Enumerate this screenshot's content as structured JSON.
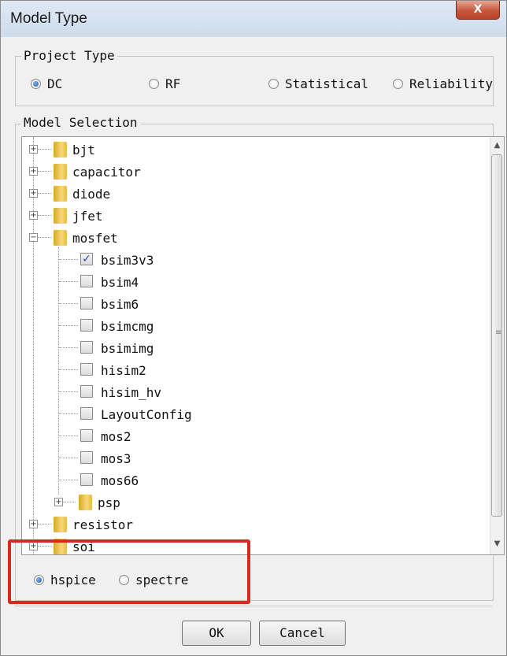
{
  "window": {
    "title": "Model Type",
    "close_glyph": "X"
  },
  "project_type": {
    "legend": "Project Type",
    "options": [
      {
        "label": "DC",
        "selected": true
      },
      {
        "label": "RF",
        "selected": false
      },
      {
        "label": "Statistical",
        "selected": false
      },
      {
        "label": "Reliability",
        "selected": false
      }
    ]
  },
  "model_selection": {
    "legend": "Model Selection",
    "tree": [
      {
        "label": "bjt",
        "type": "folder",
        "expanded": false
      },
      {
        "label": "capacitor",
        "type": "folder",
        "expanded": false
      },
      {
        "label": "diode",
        "type": "folder",
        "expanded": false
      },
      {
        "label": "jfet",
        "type": "folder",
        "expanded": false
      },
      {
        "label": "mosfet",
        "type": "folder",
        "expanded": true
      },
      {
        "label": "bsim3v3",
        "type": "check",
        "checked": true
      },
      {
        "label": "bsim4",
        "type": "check",
        "checked": false
      },
      {
        "label": "bsim6",
        "type": "check",
        "checked": false
      },
      {
        "label": "bsimcmg",
        "type": "check",
        "checked": false
      },
      {
        "label": "bsimimg",
        "type": "check",
        "checked": false
      },
      {
        "label": "hisim2",
        "type": "check",
        "checked": false
      },
      {
        "label": "hisim_hv",
        "type": "check",
        "checked": false
      },
      {
        "label": "LayoutConfig",
        "type": "check",
        "checked": false
      },
      {
        "label": "mos2",
        "type": "check",
        "checked": false
      },
      {
        "label": "mos3",
        "type": "check",
        "checked": false
      },
      {
        "label": "mos66",
        "type": "check",
        "checked": false
      },
      {
        "label": "psp",
        "type": "folder",
        "expanded": false
      },
      {
        "label": "resistor",
        "type": "folder",
        "expanded": false
      },
      {
        "label": "soi",
        "type": "folder",
        "expanded": false
      }
    ]
  },
  "simulator": {
    "options": [
      {
        "label": "hspice",
        "selected": true
      },
      {
        "label": "spectre",
        "selected": false
      }
    ]
  },
  "buttons": {
    "ok": "OK",
    "cancel": "Cancel"
  },
  "colors": {
    "highlight": "#d52b1e",
    "radio_selected": "#1f5fb4",
    "folder": "#f6d77a"
  },
  "icons": {
    "close": "close-icon",
    "folder": "folder-icon",
    "expander": "expander-icon",
    "check": "checkmark-icon"
  }
}
